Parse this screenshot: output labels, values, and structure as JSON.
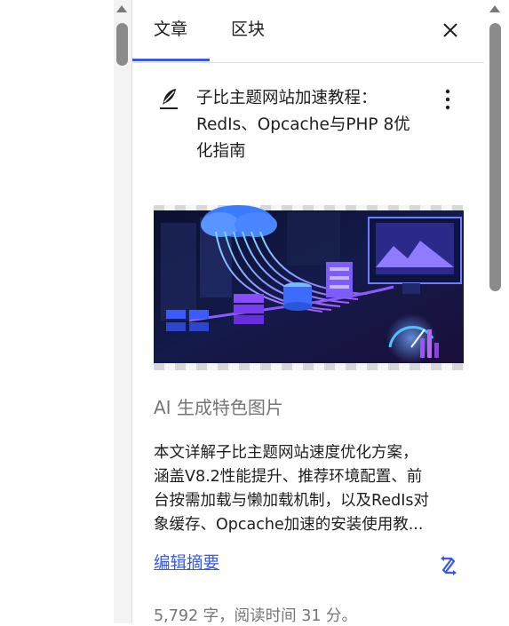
{
  "tabs": [
    {
      "label": "文章",
      "active": true
    },
    {
      "label": "区块",
      "active": false
    }
  ],
  "close_icon": "close-icon",
  "post": {
    "icon": "feather-icon",
    "title_lines": [
      "子比主题网站加速教程：",
      "RedIs、Opcache与PHP 8优",
      "化指南"
    ],
    "more_icon": "more-vertical-icon"
  },
  "featured_image": {
    "description_icon": "server-cloud-illustration"
  },
  "ai_generate_label": "AI 生成特色图片",
  "excerpt_lines": [
    "本文详解子比主题网站速度优化方案，",
    "涵盖V8.2性能提升、推荐环境配置、前",
    "台按需加载与懒加载机制，以及RedIs对",
    "象缓存、Opcache加速的安装使用教..."
  ],
  "edit_excerpt_label": "编辑摘要",
  "regen_icon": "regenerate-icon",
  "stats": "5,792 字，阅读时间 31 分。",
  "colors": {
    "accent": "#3858e9",
    "muted": "#757575",
    "text": "#1e1e1e"
  }
}
